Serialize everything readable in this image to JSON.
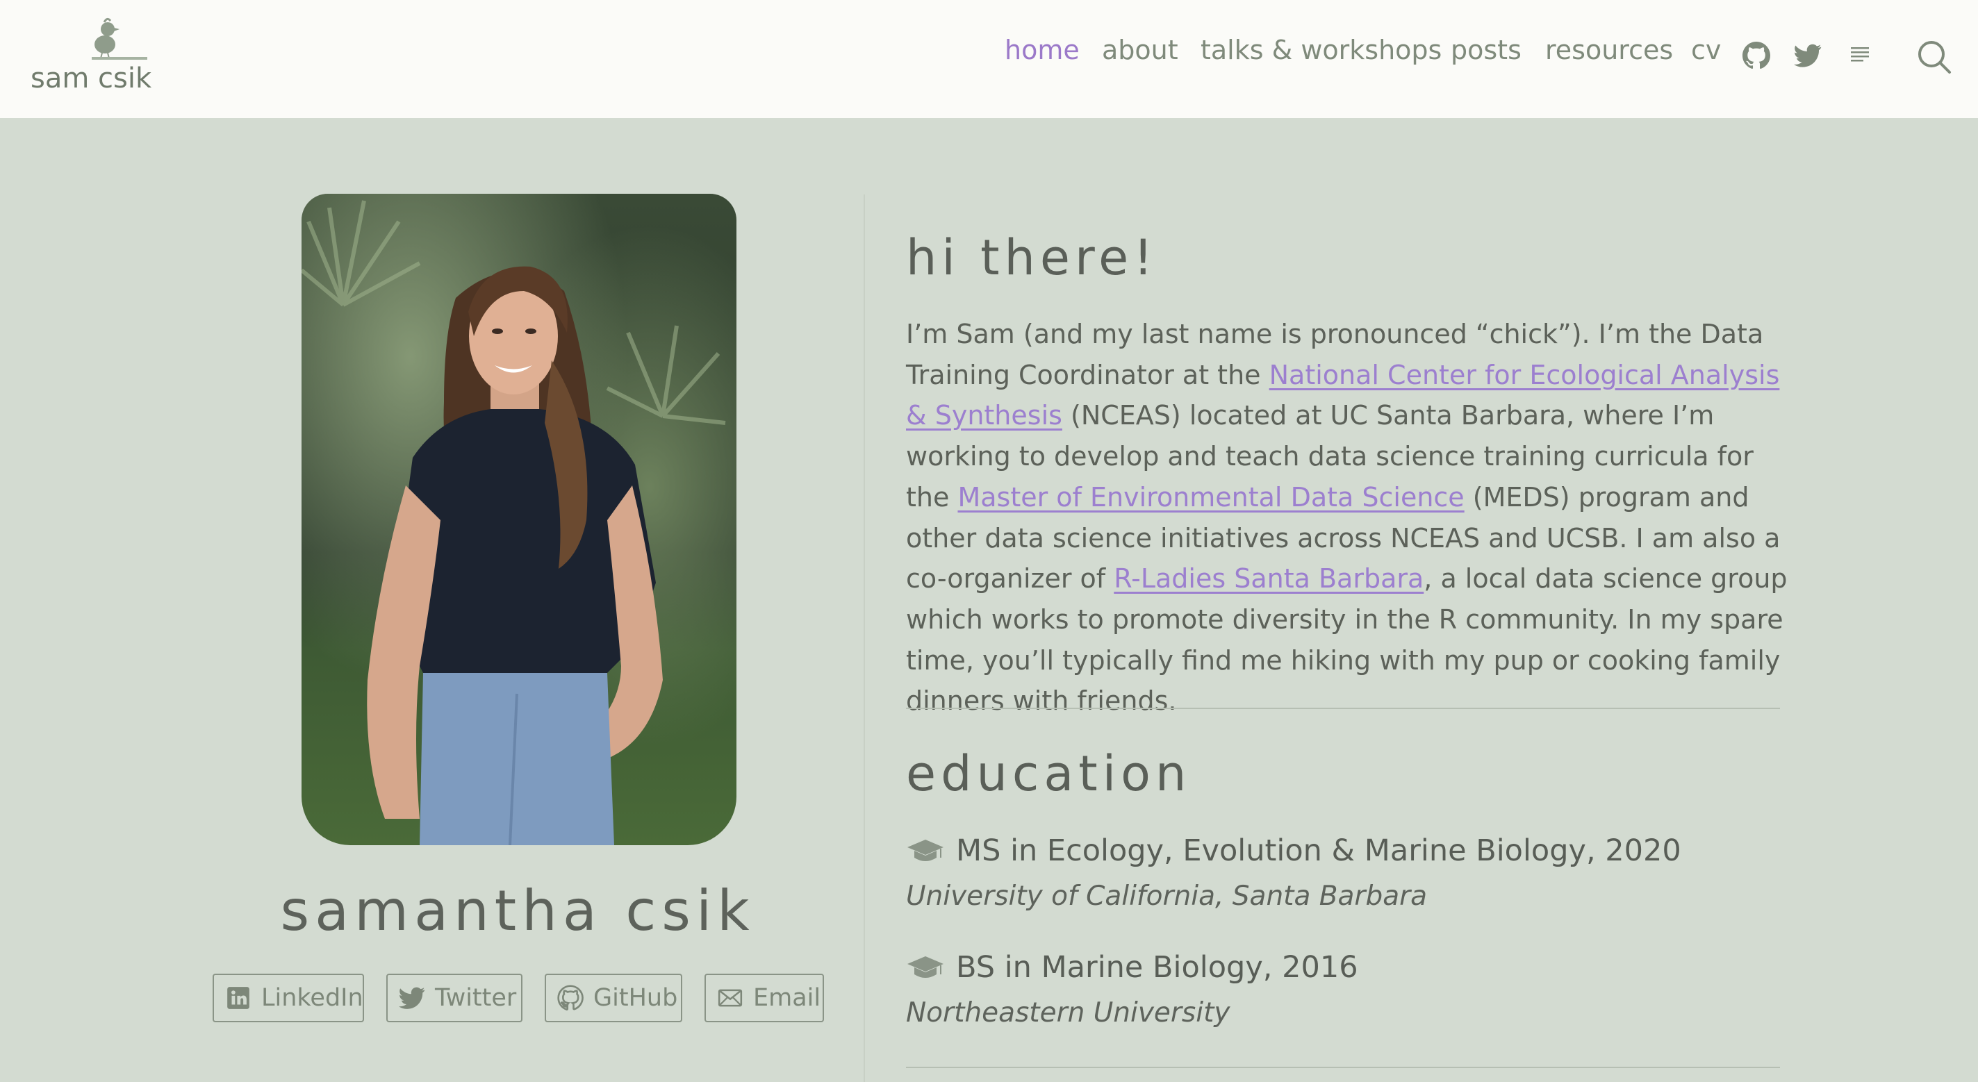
{
  "brand": {
    "name": "sam csik"
  },
  "nav": {
    "links": [
      "home",
      "about",
      "talks & workshops",
      "posts",
      "resources",
      "cv"
    ],
    "active": "home",
    "icons": [
      "github-icon",
      "twitter-icon",
      "rss-icon",
      "search-icon"
    ]
  },
  "profile": {
    "name": "samantha csik",
    "social": [
      "LinkedIn",
      "Twitter",
      "GitHub",
      "Email"
    ]
  },
  "intro": {
    "title": "hi there!",
    "p1": "I’m Sam (and my last name is pronounced “chick”). I’m the Data Training Coordinator at the ",
    "link1": "National Center for Ecological Analysis & Synthesis",
    "p2": " (NCEAS) located at UC Santa Barbara, where I’m working to develop and teach data science training curricula for the ",
    "link2": "Master of Environmental Data Science",
    "p3": " (MEDS) program and other data science initiatives across NCEAS and UCSB. I am also a co-organizer of ",
    "link3": "R-Ladies Santa Barbara",
    "p4": ", a local data science group which works to promote diversity in the R community. In my spare time, you’ll typically find me hiking with my pup or cooking family dinners with friends."
  },
  "education": {
    "title": "education",
    "items": [
      {
        "degree": "MS in Ecology, Evolution & Marine Biology, 2020",
        "school": "University of California, Santa Barbara"
      },
      {
        "degree": "BS in Marine Biology, 2016",
        "school": "Northeastern University"
      }
    ]
  },
  "colors": {
    "accent": "#9b79c9",
    "background": "#d3dbd1",
    "navbar": "#fbfbf8"
  }
}
